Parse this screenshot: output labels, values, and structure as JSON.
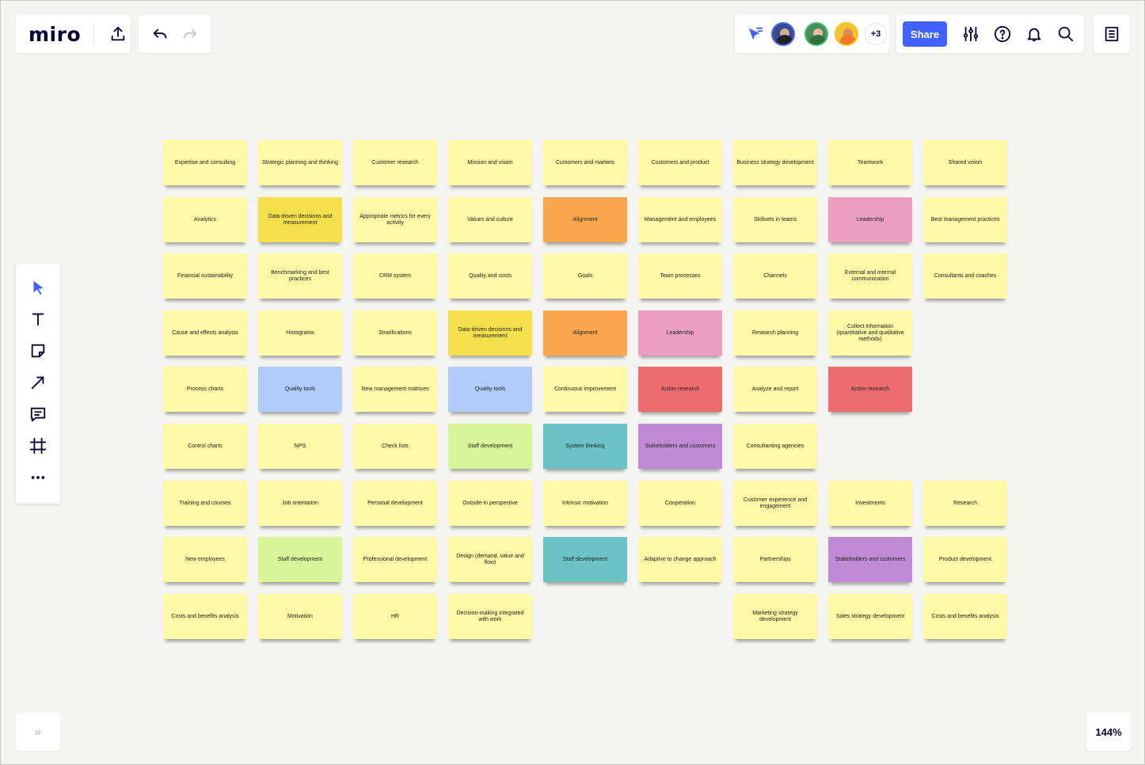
{
  "app": {
    "logo": "miro",
    "share_label": "Share",
    "more_users": "+3",
    "zoom": "144%",
    "expand_label": "»"
  },
  "colors": {
    "Y": "#fdf9a5",
    "G": "#f5df4a",
    "O": "#f9a64c",
    "P": "#eb9fbf",
    "B": "#aecbfa",
    "R": "#ed6d71",
    "L": "#d8f59a",
    "T": "#6cc3c5",
    "V": "#c08ad4"
  },
  "columns": [
    [
      [
        "Expertise and consulting",
        "Y"
      ],
      [
        "Analytics",
        "Y"
      ],
      [
        "Financial sustainability",
        "Y"
      ],
      [
        "Cause and effects analysis",
        "Y"
      ],
      [
        "Process charts",
        "Y"
      ],
      [
        "Control charts",
        "Y"
      ],
      [
        "Training and courses",
        "Y"
      ],
      [
        "New employees",
        "Y"
      ],
      [
        "Costs and benefits analysis",
        "Y"
      ]
    ],
    [
      [
        "Strategic planning and thinking",
        "Y"
      ],
      [
        "Data-driven decisions and measurement",
        "G"
      ],
      [
        "Benchmarking and best practices",
        "Y"
      ],
      [
        "Histograms",
        "Y"
      ],
      [
        "Quality tools",
        "B"
      ],
      [
        "NPS",
        "Y"
      ],
      [
        "Job orientation",
        "Y"
      ],
      [
        "Staff development",
        "L"
      ],
      [
        "Motivation",
        "Y"
      ]
    ],
    [
      [
        "Customer research",
        "Y"
      ],
      [
        "Appropriate metrics for every activity",
        "Y"
      ],
      [
        "CRM system",
        "Y"
      ],
      [
        "Stratifications",
        "Y"
      ],
      [
        "New management matrices",
        "Y"
      ],
      [
        "Check lists",
        "Y"
      ],
      [
        "Personal development",
        "Y"
      ],
      [
        "Professional development",
        "Y"
      ],
      [
        "HR",
        "Y"
      ]
    ],
    [
      [
        "Mission and vision",
        "Y"
      ],
      [
        "Values and culture",
        "Y"
      ],
      [
        "Quality and costs",
        "Y"
      ],
      [
        "Data-driven decisions and measurement",
        "G"
      ],
      [
        "Quality tools",
        "B"
      ],
      [
        "Staff development",
        "L"
      ],
      [
        "Outside-in perspective",
        "Y"
      ],
      [
        "Design (demand, value and flow)",
        "Y"
      ],
      [
        "Decision-making integrated with work",
        "Y"
      ]
    ],
    [
      [
        "Customers and markets",
        "Y"
      ],
      [
        "Alignment",
        "O"
      ],
      [
        "Goals",
        "Y"
      ],
      [
        "Alignment",
        "O"
      ],
      [
        "Continuous improvement",
        "Y"
      ],
      [
        "System thinking",
        "T"
      ],
      [
        "Intrinsic motivation",
        "Y"
      ],
      [
        "Staff development",
        "T"
      ],
      null
    ],
    [
      [
        "Customers and product",
        "Y"
      ],
      [
        "Management and employees",
        "Y"
      ],
      [
        "Team processes",
        "Y"
      ],
      [
        "Leadership",
        "P"
      ],
      [
        "Action research",
        "R"
      ],
      [
        "Stakeholders and customers",
        "V"
      ],
      [
        "Cooperation",
        "Y"
      ],
      [
        "Adaptive to change approach",
        "Y"
      ],
      null
    ],
    [
      [
        "Business strategy development",
        "Y"
      ],
      [
        "Skillsets in teams",
        "Y"
      ],
      [
        "Channels",
        "Y"
      ],
      [
        "Research planning",
        "Y"
      ],
      [
        "Analyze and report",
        "Y"
      ],
      [
        "Consultanting agencies",
        "Y"
      ],
      [
        "Customer experience and engagement",
        "Y"
      ],
      [
        "Partnerships",
        "Y"
      ],
      [
        "Marketing strategy development",
        "Y"
      ]
    ],
    [
      [
        "Teamwork",
        "Y"
      ],
      [
        "Leadership",
        "P"
      ],
      [
        "External and internal communication",
        "Y"
      ],
      [
        "Collect information (quantitative and qualitative methods)",
        "Y"
      ],
      [
        "Action research",
        "R"
      ],
      null,
      [
        "Investments",
        "Y"
      ],
      [
        "Stakeholders and customers",
        "V"
      ],
      [
        "Sales strategy development",
        "Y"
      ]
    ],
    [
      [
        "Shared vision",
        "Y"
      ],
      [
        "Best management practices",
        "Y"
      ],
      [
        "Consultants and coaches",
        "Y"
      ],
      null,
      null,
      null,
      [
        "Research",
        "Y"
      ],
      [
        "Product development",
        "Y"
      ],
      [
        "Costs and benefits analysis",
        "Y"
      ]
    ]
  ]
}
